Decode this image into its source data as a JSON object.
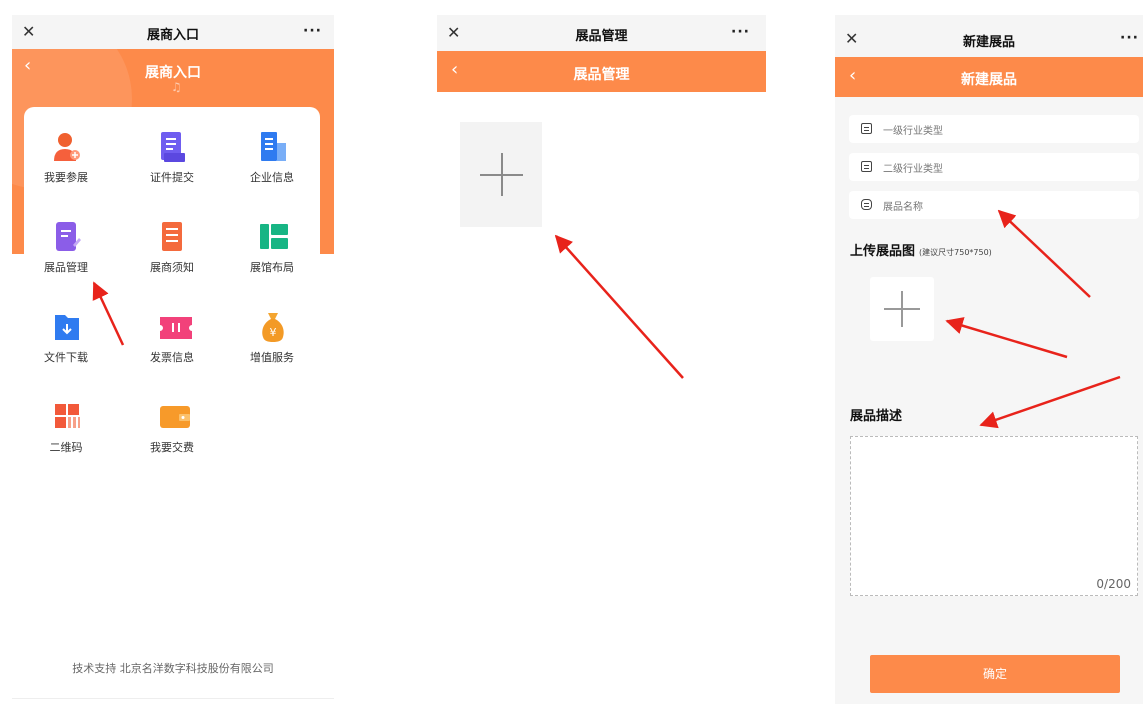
{
  "colors": {
    "accent": "#fd8a4a",
    "arrow": "#e8231b"
  },
  "screen1": {
    "window_title": "展商入口",
    "close_icon": "✕",
    "more_icon": "···",
    "back_icon": "‹",
    "header_title": "展商入口",
    "menu_items": [
      {
        "label": "我要参展",
        "icon": "user-add-icon"
      },
      {
        "label": "证件提交",
        "icon": "document-icon"
      },
      {
        "label": "企业信息",
        "icon": "building-icon"
      },
      {
        "label": "展品管理",
        "icon": "edit-file-icon"
      },
      {
        "label": "展商须知",
        "icon": "notice-icon"
      },
      {
        "label": "展馆布局",
        "icon": "layout-icon"
      },
      {
        "label": "文件下载",
        "icon": "download-icon"
      },
      {
        "label": "发票信息",
        "icon": "ticket-icon"
      },
      {
        "label": "增值服务",
        "icon": "money-bag-icon"
      },
      {
        "label": "二维码",
        "icon": "qr-code-icon"
      },
      {
        "label": "我要交费",
        "icon": "wallet-icon"
      }
    ],
    "footer": "技术支持 北京名洋数字科技股份有限公司"
  },
  "screen2": {
    "window_title": "展品管理",
    "close_icon": "✕",
    "more_icon": "···",
    "back_icon": "‹",
    "header_title": "展品管理"
  },
  "screen3": {
    "window_title": "新建展品",
    "close_icon": "✕",
    "more_icon": "···",
    "back_icon": "‹",
    "header_title": "新建展品",
    "fields": [
      {
        "placeholder": "一级行业类型"
      },
      {
        "placeholder": "二级行业类型"
      },
      {
        "placeholder": "展品名称"
      }
    ],
    "upload_title": "上传展品图",
    "upload_hint": "(建议尺寸750*750)",
    "desc_title": "展品描述",
    "desc_counter": "0/200",
    "confirm_label": "确定"
  }
}
